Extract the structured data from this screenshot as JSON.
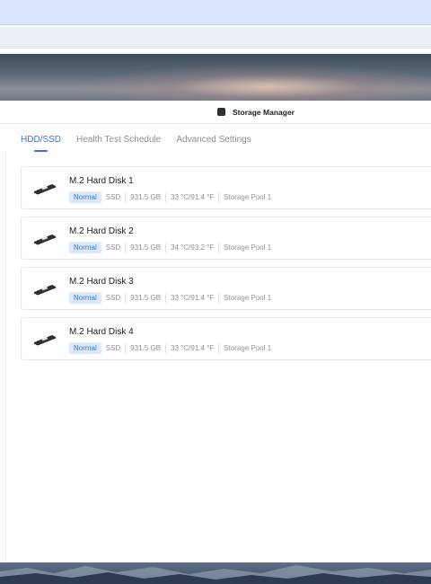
{
  "window": {
    "title": "Storage Manager"
  },
  "tabs": [
    {
      "label": "HDD/SSD",
      "active": true
    },
    {
      "label": "Health Test Schedule",
      "active": false
    },
    {
      "label": "Advanced Settings",
      "active": false
    }
  ],
  "disks": [
    {
      "name": "M.2 Hard Disk 1",
      "status": "Normal",
      "type": "SSD",
      "capacity": "931.5 GB",
      "temperature": "33 °C/91.4 °F",
      "pool": "Storage Pool 1"
    },
    {
      "name": "M.2 Hard Disk 2",
      "status": "Normal",
      "type": "SSD",
      "capacity": "931.5 GB",
      "temperature": "34 °C/93.2 °F",
      "pool": "Storage Pool 1"
    },
    {
      "name": "M.2 Hard Disk 3",
      "status": "Normal",
      "type": "SSD",
      "capacity": "931.5 GB",
      "temperature": "33 °C/91.4 °F",
      "pool": "Storage Pool 1"
    },
    {
      "name": "M.2 Hard Disk 4",
      "status": "Normal",
      "type": "SSD",
      "capacity": "931.5 GB",
      "temperature": "33 °C/91.4 °F",
      "pool": "Storage Pool 1"
    }
  ],
  "icons": {
    "app": "storage-manager-icon",
    "disk": "m2-ssd-icon"
  },
  "colors": {
    "accent": "#3873d8",
    "badge_bg": "#dce8fb",
    "badge_text": "#3b74d6"
  }
}
